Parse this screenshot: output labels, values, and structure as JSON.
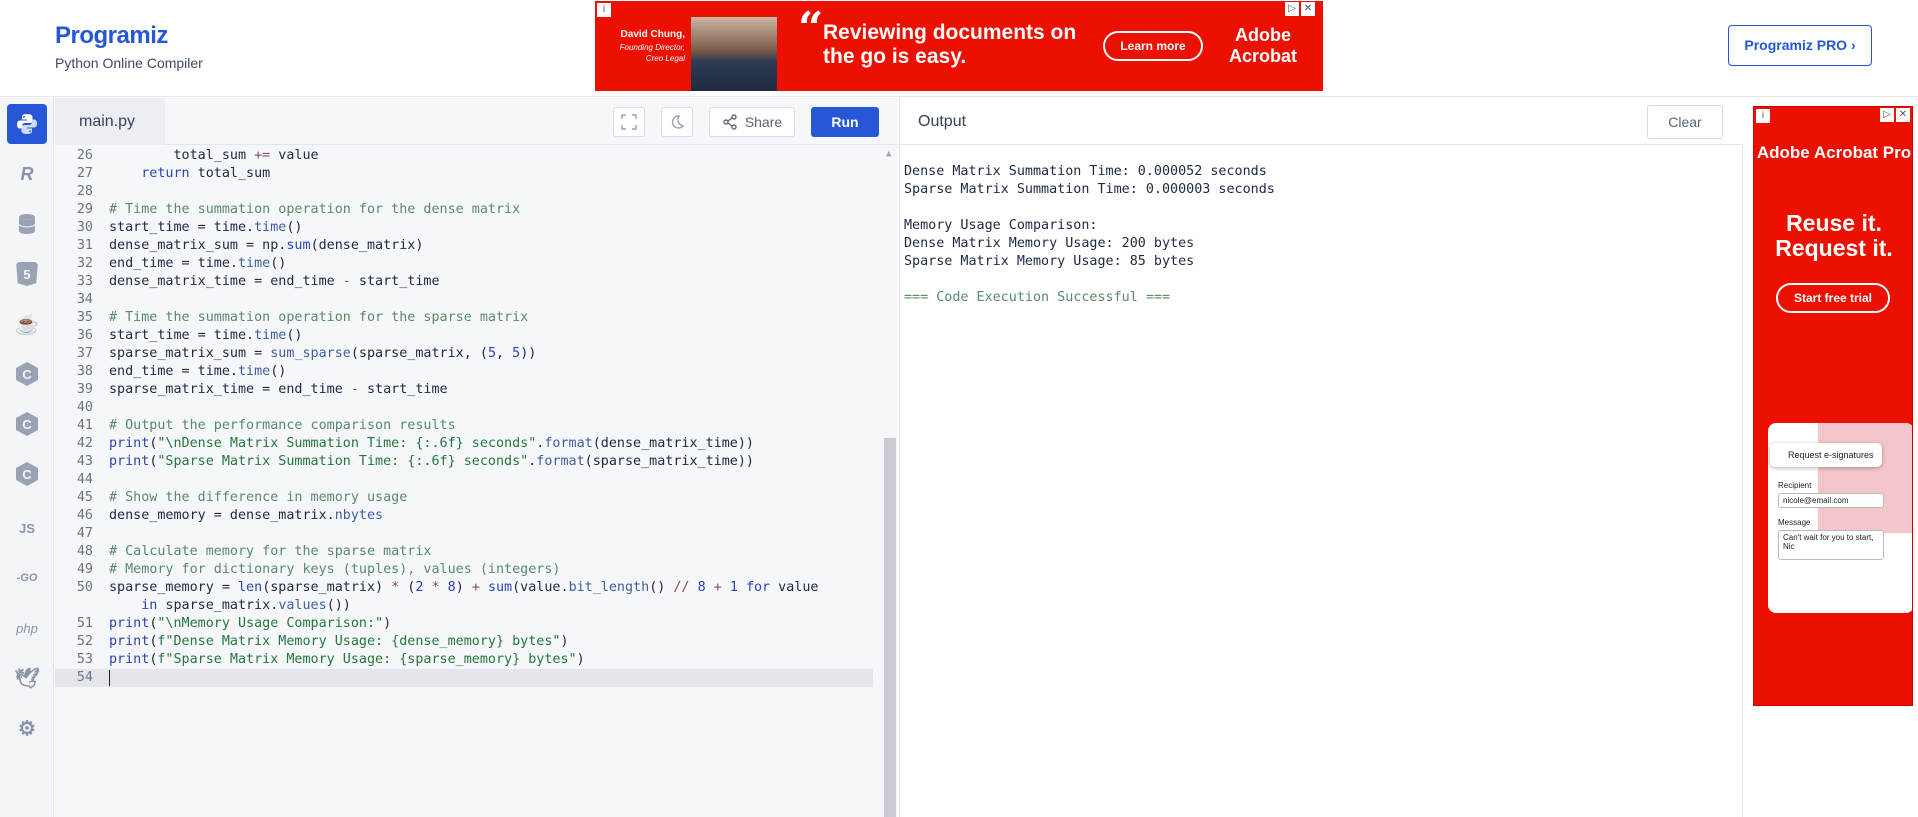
{
  "header": {
    "logo_text": "rogramiz",
    "logo_initial": "P",
    "subtitle": "Python Online Compiler",
    "pro_button": "Programiz PRO ›"
  },
  "ad_top": {
    "person_name": "David Chung,",
    "person_role": "Founding Director, Creo Legal",
    "headline": "Reviewing documents on the go is easy.",
    "cta": "Learn more",
    "brand": "Adobe Acrobat"
  },
  "sidebar": {
    "items": [
      {
        "name": "python",
        "label": "Py"
      },
      {
        "name": "r",
        "label": "R"
      },
      {
        "name": "sql",
        "label": "DB"
      },
      {
        "name": "html",
        "label": "5"
      },
      {
        "name": "java",
        "label": "J"
      },
      {
        "name": "c",
        "label": "C"
      },
      {
        "name": "cpp",
        "label": "C"
      },
      {
        "name": "csharp",
        "label": "C"
      },
      {
        "name": "javascript",
        "label": "JS"
      },
      {
        "name": "go",
        "label": "-GO"
      },
      {
        "name": "php",
        "label": "php"
      },
      {
        "name": "swift",
        "label": "S"
      },
      {
        "name": "rust",
        "label": "R"
      }
    ]
  },
  "editor": {
    "tab_label": "main.py",
    "share_label": "Share",
    "run_label": "Run"
  },
  "code_lines": [
    {
      "n": "26",
      "t": "        total_sum += value"
    },
    {
      "n": "27",
      "t": "    return total_sum"
    },
    {
      "n": "28",
      "t": ""
    },
    {
      "n": "29",
      "t": "# Time the summation operation for the dense matrix"
    },
    {
      "n": "30",
      "t": "start_time = time.time()"
    },
    {
      "n": "31",
      "t": "dense_matrix_sum = np.sum(dense_matrix)"
    },
    {
      "n": "32",
      "t": "end_time = time.time()"
    },
    {
      "n": "33",
      "t": "dense_matrix_time = end_time - start_time"
    },
    {
      "n": "34",
      "t": ""
    },
    {
      "n": "35",
      "t": "# Time the summation operation for the sparse matrix"
    },
    {
      "n": "36",
      "t": "start_time = time.time()"
    },
    {
      "n": "37",
      "t": "sparse_matrix_sum = sum_sparse(sparse_matrix, (5, 5))"
    },
    {
      "n": "38",
      "t": "end_time = time.time()"
    },
    {
      "n": "39",
      "t": "sparse_matrix_time = end_time - start_time"
    },
    {
      "n": "40",
      "t": ""
    },
    {
      "n": "41",
      "t": "# Output the performance comparison results"
    },
    {
      "n": "42",
      "t": "print(\"\\nDense Matrix Summation Time: {:.6f} seconds\".format(dense_matrix_time))"
    },
    {
      "n": "43",
      "t": "print(\"Sparse Matrix Summation Time: {:.6f} seconds\".format(sparse_matrix_time))"
    },
    {
      "n": "44",
      "t": ""
    },
    {
      "n": "45",
      "t": "# Show the difference in memory usage"
    },
    {
      "n": "46",
      "t": "dense_memory = dense_matrix.nbytes"
    },
    {
      "n": "47",
      "t": ""
    },
    {
      "n": "48",
      "t": "# Calculate memory for the sparse matrix"
    },
    {
      "n": "49",
      "t": "# Memory for dictionary keys (tuples), values (integers)"
    },
    {
      "n": "50",
      "t": "sparse_memory = len(sparse_matrix) * (2 * 8) + sum(value.bit_length() // 8 + 1 for value"
    },
    {
      "n": "",
      "t": "    in sparse_matrix.values())"
    },
    {
      "n": "51",
      "t": "print(\"\\nMemory Usage Comparison:\")"
    },
    {
      "n": "52",
      "t": "print(f\"Dense Matrix Memory Usage: {dense_memory} bytes\")"
    },
    {
      "n": "53",
      "t": "print(f\"Sparse Matrix Memory Usage: {sparse_memory} bytes\")"
    },
    {
      "n": "54",
      "t": ""
    }
  ],
  "output": {
    "title": "Output",
    "clear_label": "Clear",
    "lines": [
      "Dense Matrix Summation Time: 0.000052 seconds",
      "Sparse Matrix Summation Time: 0.000003 seconds",
      "",
      "Memory Usage Comparison:",
      "Dense Matrix Memory Usage: 200 bytes",
      "Sparse Matrix Memory Usage: 85 bytes",
      "",
      "=== Code Execution Successful ==="
    ]
  },
  "ad_side": {
    "brand": "Adobe Acrobat Pro",
    "headline": "Reuse it. Request it.",
    "cta": "Start free trial",
    "chip": "Request e-signatures",
    "recipient_label": "Recipient",
    "recipient_value": "nicole@email.com",
    "message_label": "Message",
    "message_value": "Can't wait for you to start, Nic"
  },
  "colors": {
    "brand": "#2557d6",
    "ad_red": "#eb1000",
    "comment": "#5a8a6a",
    "string": "#24773a"
  }
}
